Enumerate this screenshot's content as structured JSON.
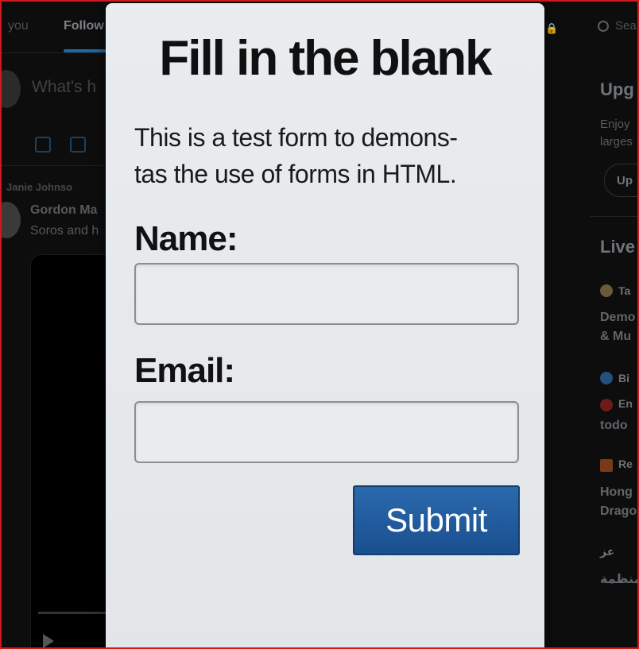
{
  "background": {
    "tabs": {
      "you": "you",
      "following": "Follow"
    },
    "compose": {
      "placeholder": "What's h"
    },
    "post": {
      "repost_by": "Janie Johnso",
      "author": "Gordon Ma",
      "snippet": "Soros and h"
    },
    "sidebar": {
      "search": "Sea",
      "upgrade": {
        "title": "Upg",
        "text_line1": "Enjoy",
        "text_line2": "larges",
        "button": "Up"
      },
      "live": {
        "title": "Live",
        "items": [
          {
            "name": "Ta",
            "text_line1": "Demo",
            "text_line2": "& Mu"
          },
          {
            "name": "Bi"
          },
          {
            "name": "En",
            "text_line1": "todo"
          },
          {
            "name": "Re",
            "text_line1": "Hong",
            "text_line2": "Drago"
          },
          {
            "name": "عز",
            "text_line1": "منظمة"
          }
        ]
      }
    }
  },
  "modal": {
    "title": "Fill in the blank",
    "description_line1": "This is a test form to demons-",
    "description_line2": "tas the use of forms in HTML.",
    "name_label": "Name:",
    "name_value": "",
    "email_label": "Email:",
    "email_value": "",
    "submit_label": "Submit"
  },
  "colors": {
    "submit": "#1f5b9d",
    "frame_border": "#d21919",
    "modal_bg": "#e6e9ec"
  }
}
